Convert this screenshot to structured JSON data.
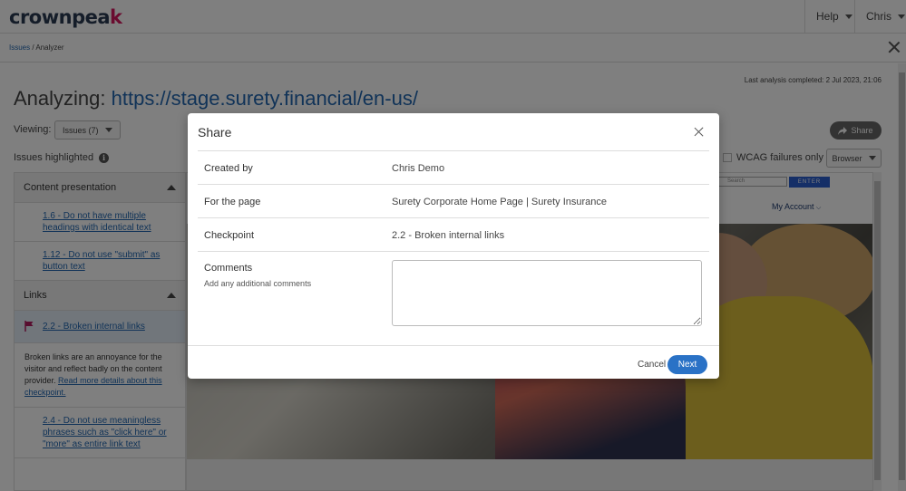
{
  "header": {
    "logo_text": "crownpeak",
    "help_label": "Help",
    "user_label": "Chris"
  },
  "breadcrumb": {
    "issues": "Issues",
    "separator": "/",
    "analyzer": "Analyzer"
  },
  "last_analysis": "Last analysis completed: 2 Jul 2023, 21:06",
  "page_title": {
    "prefix": "Analyzing: ",
    "url": "https://stage.surety.financial/en-us/"
  },
  "viewing": {
    "label": "Viewing:",
    "selected": "Issues (7)"
  },
  "toolbar": {
    "share_label": "Share",
    "wcag_label": "WCAG failures only",
    "browser_label": "Browser"
  },
  "issues_highlighted": "Issues highlighted",
  "sidebar": {
    "sections": [
      {
        "title": "Content presentation",
        "items": [
          "1.6 - Do not have multiple headings with identical text",
          "1.12 - Do not use \"submit\" as button text"
        ]
      },
      {
        "title": "Links",
        "active_item": "2.2 - Broken internal links",
        "description": "Broken links are an annoyance for the visitor and reflect badly on the content provider.",
        "description_link": "Read more details about this checkpoint.",
        "items": [
          "2.4 - Do not use meaningless phrases such as \"click here\" or \"more\" as entire link text"
        ]
      }
    ]
  },
  "preview": {
    "search_placeholder": "Search",
    "enter_label": "ENTER",
    "my_account": "My Account"
  },
  "modal": {
    "title": "Share",
    "rows": [
      {
        "label": "Created by",
        "value": "Chris Demo"
      },
      {
        "label": "For the page",
        "value": "Surety Corporate Home Page | Surety Insurance"
      },
      {
        "label": "Checkpoint",
        "value": "2.2 - Broken internal links"
      }
    ],
    "comments_label": "Comments",
    "comments_hint": "Add any additional comments",
    "comments_value": "",
    "cancel_label": "Cancel",
    "next_label": "Next"
  },
  "colors": {
    "accent": "#2a72c6",
    "link": "#2267b0",
    "brand_pink": "#d4165f",
    "flag": "#b01a5e"
  }
}
